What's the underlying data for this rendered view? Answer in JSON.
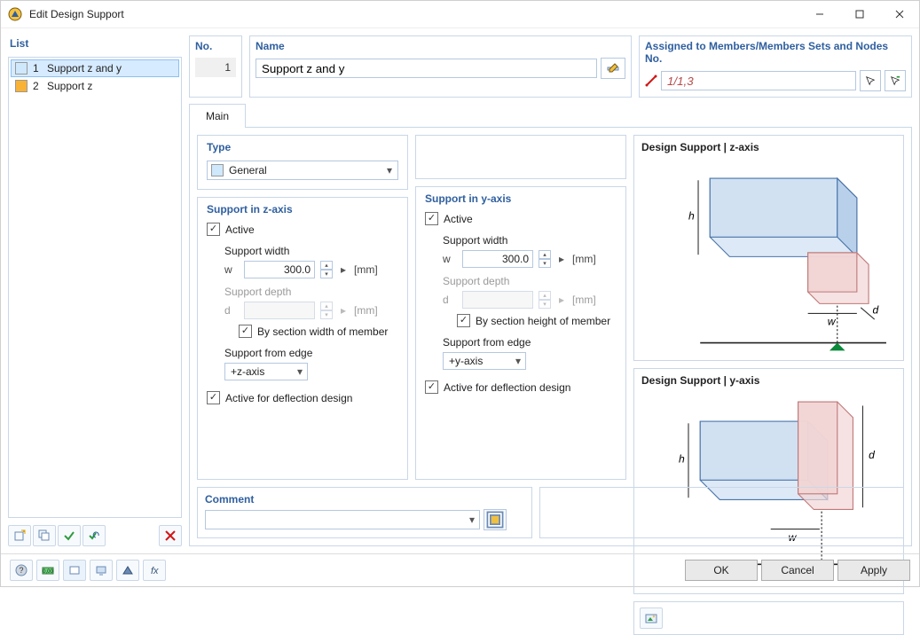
{
  "window": {
    "title": "Edit Design Support"
  },
  "list": {
    "header": "List",
    "items": [
      {
        "idx": "1",
        "label": "Support z and y",
        "color": "#cfe8fb",
        "selected": true
      },
      {
        "idx": "2",
        "label": "Support z",
        "color": "#f9b233",
        "selected": false
      }
    ]
  },
  "top": {
    "no_header": "No.",
    "no_value": "1",
    "name_header": "Name",
    "name_value": "Support z and y",
    "assigned_header": "Assigned to Members/Members Sets and Nodes No.",
    "assigned_value": "1/1,3"
  },
  "tabs": {
    "main": "Main"
  },
  "type_section": {
    "legend": "Type",
    "value": "General",
    "swatch": "#cfe8fb"
  },
  "z": {
    "legend": "Support in z-axis",
    "active": "Active",
    "width_label": "Support width",
    "width_sym": "w",
    "width_val": "300.0",
    "width_unit": "[mm]",
    "depth_label": "Support depth",
    "depth_sym": "d",
    "depth_unit": "[mm]",
    "by_section": "By section width of member",
    "edge_label": "Support from edge",
    "edge_value": "+z-axis",
    "deflection": "Active for deflection design"
  },
  "y": {
    "legend": "Support in y-axis",
    "active": "Active",
    "width_label": "Support width",
    "width_sym": "w",
    "width_val": "300.0",
    "width_unit": "[mm]",
    "depth_label": "Support depth",
    "depth_sym": "d",
    "depth_unit": "[mm]",
    "by_section": "By section height of member",
    "edge_label": "Support from edge",
    "edge_value": "+y-axis",
    "deflection": "Active for deflection design"
  },
  "preview": {
    "z_title": "Design Support | z-axis",
    "y_title": "Design Support | y-axis"
  },
  "comment": {
    "legend": "Comment"
  },
  "buttons": {
    "ok": "OK",
    "cancel": "Cancel",
    "apply": "Apply"
  }
}
